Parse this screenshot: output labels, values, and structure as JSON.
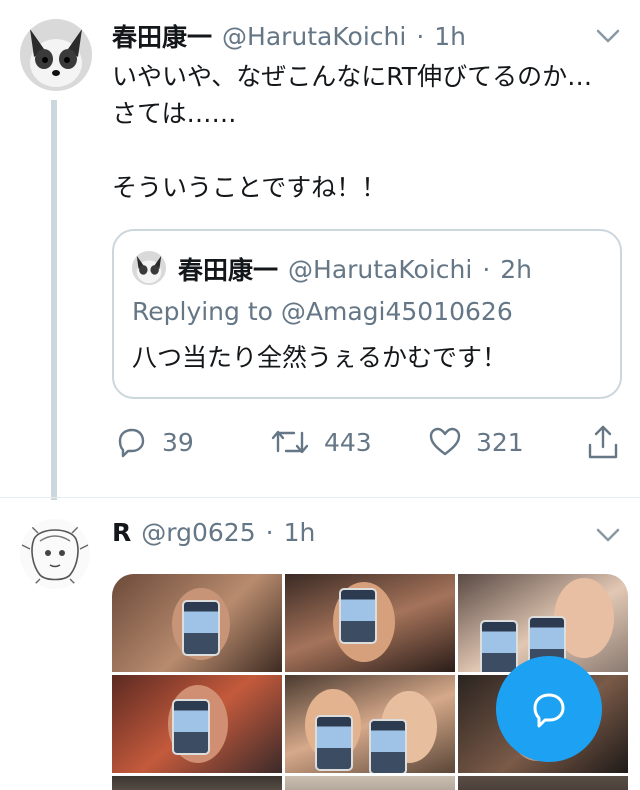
{
  "tweet1": {
    "display_name": "春田康一",
    "handle": "@HarutaKoichi",
    "separator": "·",
    "time": "1h",
    "text": "いやいや、なぜこんなにRT伸びてるのか…\nさては……\n\nそういうことですね！！",
    "quote": {
      "display_name": "春田康一",
      "handle": "@HarutaKoichi",
      "separator": "·",
      "time": "2h",
      "replying_to": "Replying to @Amagi45010626",
      "text": "八つ当たり全然うぇるかむです！"
    },
    "actions": {
      "reply_count": "39",
      "retweet_count": "443",
      "like_count": "321"
    }
  },
  "tweet2": {
    "display_name": "R",
    "handle": "@rg0625",
    "separator": "·",
    "time": "1h"
  },
  "colors": {
    "primary_text": "#14171a",
    "secondary_text": "#657786",
    "accent": "#1da1f2",
    "border": "#ccd6dd"
  },
  "icons": {
    "reply": "reply-icon",
    "retweet": "retweet-icon",
    "like": "heart-icon",
    "share": "share-icon",
    "caret": "chevron-down-icon",
    "compose": "compose-reply-icon"
  }
}
